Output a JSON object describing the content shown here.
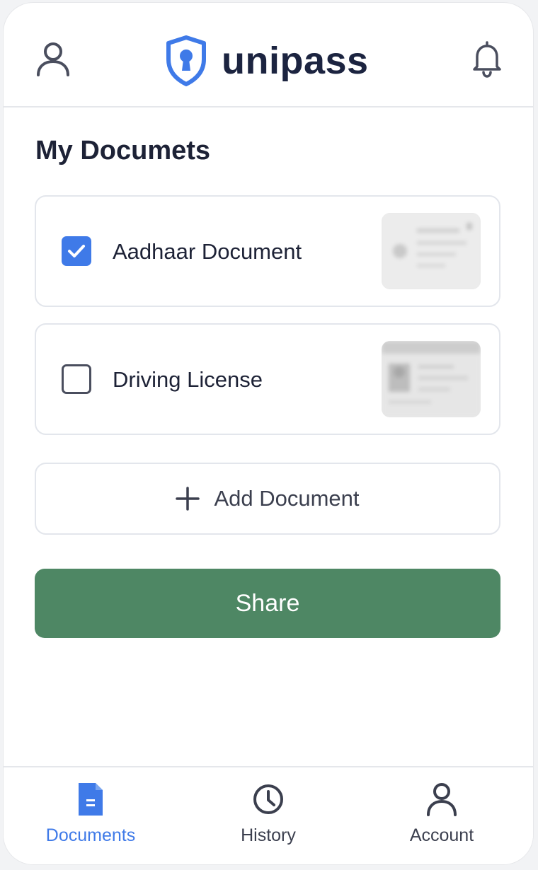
{
  "header": {
    "brand_name": "unipass",
    "profile_icon": "user-icon",
    "bell_icon": "bell-icon",
    "shield_icon": "shield-keyhole-icon"
  },
  "main": {
    "title": "My Documets",
    "documents": [
      {
        "label": "Aadhaar Document",
        "checked": true
      },
      {
        "label": "Driving License",
        "checked": false
      }
    ],
    "add_document_label": "Add Document",
    "share_label": "Share"
  },
  "bottom_nav": {
    "items": [
      {
        "label": "Documents",
        "icon": "document-icon",
        "active": true
      },
      {
        "label": "History",
        "icon": "clock-icon",
        "active": false
      },
      {
        "label": "Account",
        "icon": "user-icon",
        "active": false
      }
    ]
  },
  "colors": {
    "accent_blue": "#3f7ae8",
    "share_green": "#4e8764",
    "text_dark": "#1d2236"
  }
}
